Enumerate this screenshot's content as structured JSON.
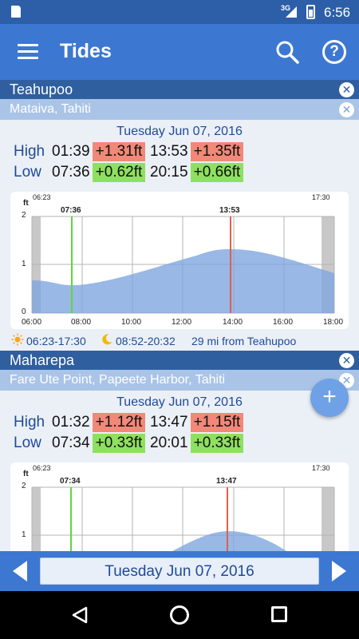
{
  "status": {
    "network": "3G",
    "time": "6:56"
  },
  "app_bar": {
    "title": "Tides"
  },
  "stations": [
    {
      "name": "Teahupoo",
      "location": "Mataiva, Tahiti",
      "date": "Tuesday Jun 07, 2016",
      "high": {
        "label": "High",
        "time1": "01:39",
        "value1": "+1.31ft",
        "time2": "13:53",
        "value2": "+1.35ft"
      },
      "low": {
        "label": "Low",
        "time1": "07:36",
        "value1": "+0.62ft",
        "time2": "20:15",
        "value2": "+0.66ft"
      },
      "chart": {
        "unit": "ft",
        "sunrise_label": "06:23",
        "sunset_label": "17:30",
        "low_marker": "07:36",
        "high_marker": "13:53",
        "y_ticks": [
          "2",
          "1",
          "0"
        ],
        "x_ticks": [
          "06:00",
          "08:00",
          "10:00",
          "12:00",
          "14:00",
          "16:00",
          "18:00"
        ]
      },
      "sun": "06:23-17:30",
      "moon": "08:52-20:32",
      "distance": "29 mi from Teahupoo"
    },
    {
      "name": "Maharepa",
      "location": "Fare Ute Point, Papeete Harbor, Tahiti",
      "date": "Tuesday Jun 07, 2016",
      "high": {
        "label": "High",
        "time1": "01:32",
        "value1": "+1.12ft",
        "time2": "13:47",
        "value2": "+1.15ft"
      },
      "low": {
        "label": "Low",
        "time1": "07:34",
        "value1": "+0.33ft",
        "time2": "20:01",
        "value2": "+0.33ft"
      },
      "chart": {
        "unit": "ft",
        "sunrise_label": "06:23",
        "sunset_label": "17:30",
        "low_marker": "07:34",
        "high_marker": "13:47",
        "y_ticks": [
          "2",
          "1"
        ]
      }
    }
  ],
  "date_nav": {
    "date": "Tuesday Jun 07, 2016"
  },
  "fab": {
    "label": "+"
  },
  "chart_data": [
    {
      "type": "area",
      "title": "",
      "ylabel": "ft",
      "ylim": [
        0,
        2
      ],
      "xlim": [
        "06:00",
        "18:30"
      ],
      "x": [
        "06:00",
        "07:36",
        "10:00",
        "12:00",
        "13:53",
        "16:00",
        "18:30"
      ],
      "values": [
        0.66,
        0.62,
        0.85,
        1.22,
        1.35,
        1.22,
        0.82
      ]
    },
    {
      "type": "area",
      "title": "",
      "ylabel": "ft",
      "ylim": [
        0,
        2
      ],
      "x": [
        "06:00",
        "07:34",
        "10:00",
        "12:00",
        "13:47"
      ],
      "values": [
        0.4,
        0.33,
        0.55,
        1.0,
        1.15
      ]
    }
  ],
  "colors": {
    "app_bar": "#3c78d2",
    "status_bar": "#2d5fa8",
    "high_badge": "#f28878",
    "low_badge": "#8ee060",
    "chart_fill": "#7fa6de",
    "high_line": "#e0604c",
    "low_line": "#5ed63e"
  }
}
